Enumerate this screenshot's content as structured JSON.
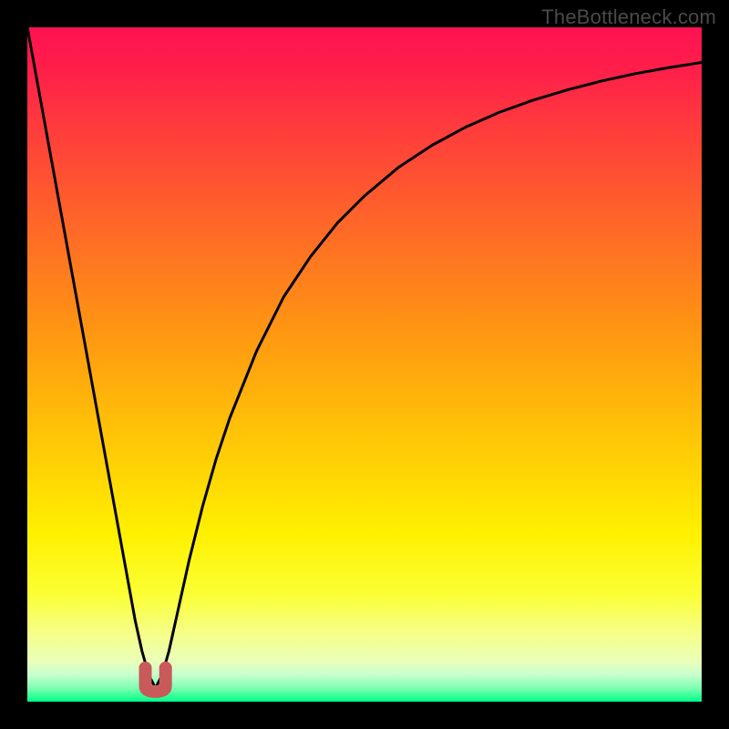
{
  "watermark": "TheBottleneck.com",
  "colors": {
    "curve": "#000000",
    "valley_marker": "#c95a5a",
    "gradient_top": "#ff1252",
    "gradient_bottom": "#00ff88",
    "frame": "#000000"
  },
  "chart_data": {
    "type": "line",
    "title": "",
    "xlabel": "",
    "ylabel": "",
    "xlim": [
      0,
      100
    ],
    "ylim": [
      0,
      100
    ],
    "valley_x": 19,
    "valley_marker_xrange": [
      17.5,
      20.5
    ],
    "series": [
      {
        "name": "bottleneck-curve",
        "x": [
          0,
          2,
          4,
          6,
          8,
          10,
          12,
          14,
          16,
          17,
          18,
          19,
          20,
          21,
          22,
          24,
          26,
          28,
          30,
          34,
          38,
          42,
          46,
          50,
          55,
          60,
          65,
          70,
          75,
          80,
          85,
          90,
          95,
          100
        ],
        "y": [
          100,
          89,
          78,
          67,
          56,
          45,
          34,
          23,
          12,
          7.5,
          4,
          2,
          4,
          7.5,
          12,
          21,
          29,
          36,
          42,
          52,
          60,
          66,
          71,
          75,
          79.2,
          82.5,
          85.2,
          87.4,
          89.2,
          90.7,
          92,
          93.1,
          94,
          94.8
        ]
      }
    ],
    "annotations": []
  }
}
